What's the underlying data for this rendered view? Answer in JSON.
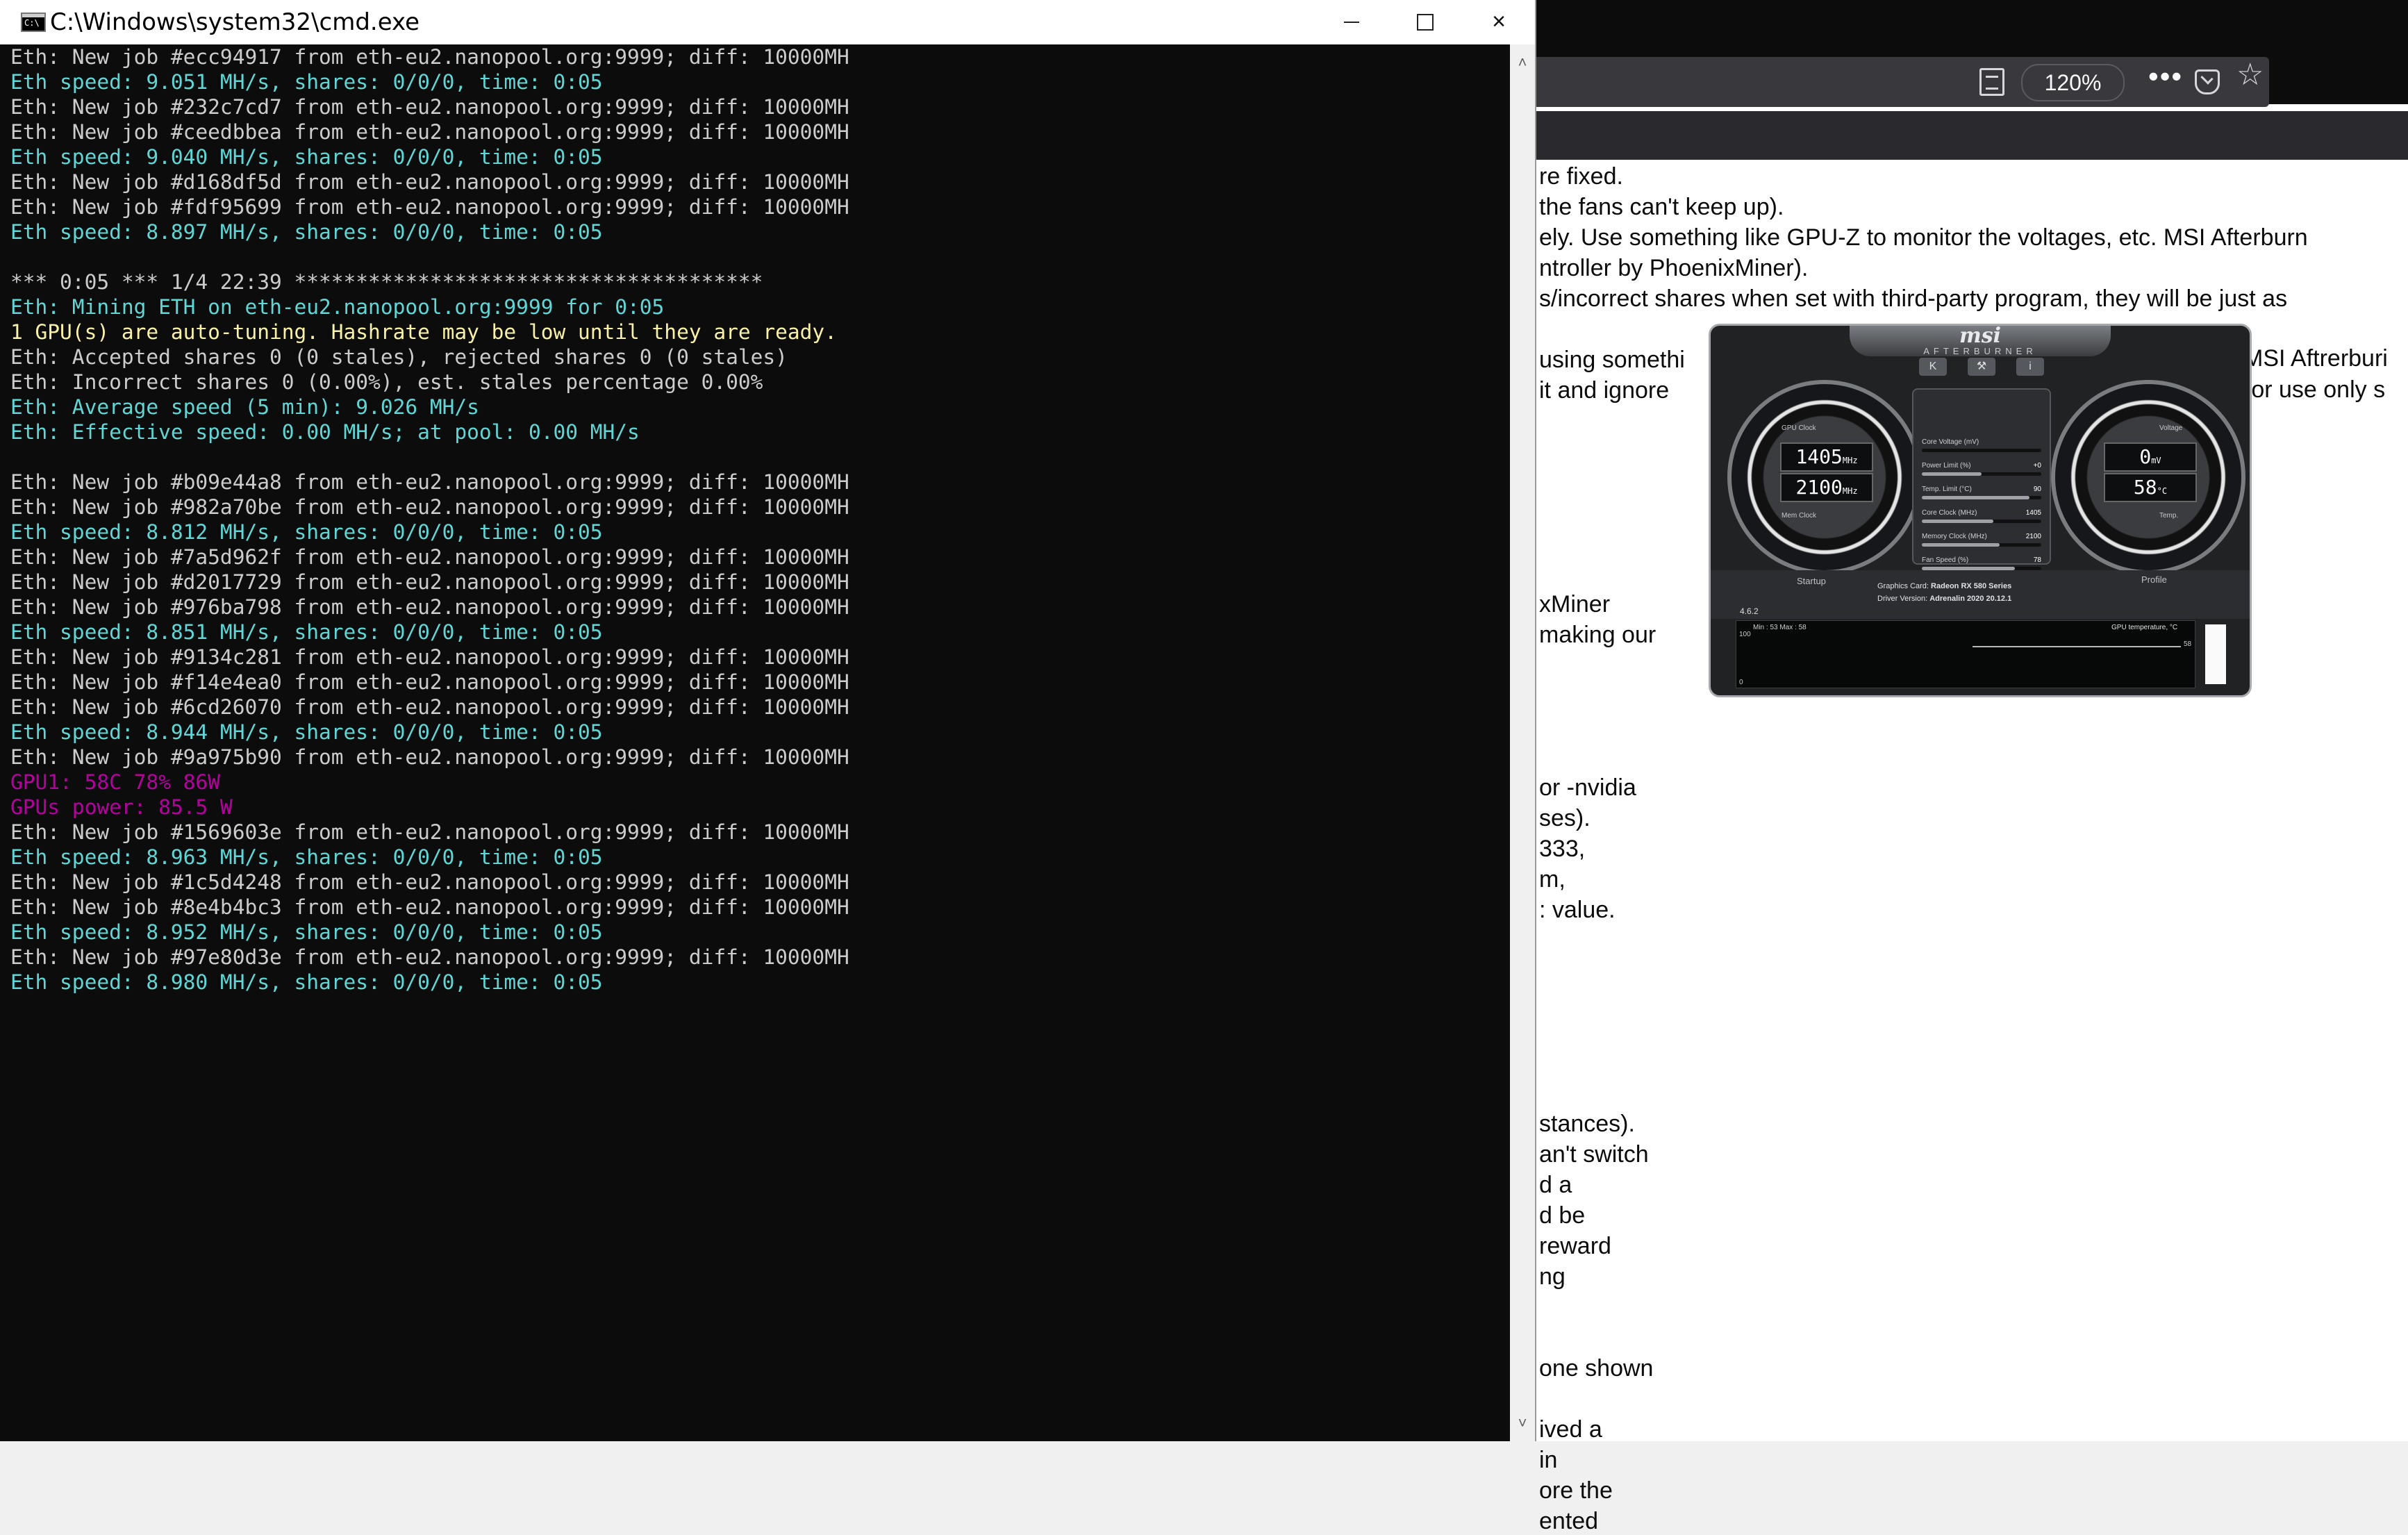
{
  "cmd": {
    "title": "C:\\Windows\\system32\\cmd.exe",
    "lines": [
      {
        "text": "Eth: New job #ecc94917 from eth-eu2.nanopool.org:9999; diff: 10000MH",
        "color": "white"
      },
      {
        "text": "Eth speed: 9.051 MH/s, shares: 0/0/0, time: 0:05",
        "color": "cyan"
      },
      {
        "text": "Eth: New job #232c7cd7 from eth-eu2.nanopool.org:9999; diff: 10000MH",
        "color": "white"
      },
      {
        "text": "Eth: New job #ceedbbea from eth-eu2.nanopool.org:9999; diff: 10000MH",
        "color": "white"
      },
      {
        "text": "Eth speed: 9.040 MH/s, shares: 0/0/0, time: 0:05",
        "color": "cyan"
      },
      {
        "text": "Eth: New job #d168df5d from eth-eu2.nanopool.org:9999; diff: 10000MH",
        "color": "white"
      },
      {
        "text": "Eth: New job #fdf95699 from eth-eu2.nanopool.org:9999; diff: 10000MH",
        "color": "white"
      },
      {
        "text": "Eth speed: 8.897 MH/s, shares: 0/0/0, time: 0:05",
        "color": "cyan"
      },
      {
        "text": "",
        "color": "white"
      },
      {
        "text": "*** 0:05 *** 1/4 22:39 **************************************",
        "color": "white"
      },
      {
        "text": "Eth: Mining ETH on eth-eu2.nanopool.org:9999 for 0:05",
        "color": "cyan"
      },
      {
        "text": "1 GPU(s) are auto-tuning. Hashrate may be low until they are ready.",
        "color": "yellow"
      },
      {
        "text": "Eth: Accepted shares 0 (0 stales), rejected shares 0 (0 stales)",
        "color": "white"
      },
      {
        "text": "Eth: Incorrect shares 0 (0.00%), est. stales percentage 0.00%",
        "color": "white"
      },
      {
        "text": "Eth: Average speed (5 min): 9.026 MH/s",
        "color": "cyan"
      },
      {
        "text": "Eth: Effective speed: 0.00 MH/s; at pool: 0.00 MH/s",
        "color": "cyan"
      },
      {
        "text": "",
        "color": "white"
      },
      {
        "text": "Eth: New job #b09e44a8 from eth-eu2.nanopool.org:9999; diff: 10000MH",
        "color": "white"
      },
      {
        "text": "Eth: New job #982a70be from eth-eu2.nanopool.org:9999; diff: 10000MH",
        "color": "white"
      },
      {
        "text": "Eth speed: 8.812 MH/s, shares: 0/0/0, time: 0:05",
        "color": "cyan"
      },
      {
        "text": "Eth: New job #7a5d962f from eth-eu2.nanopool.org:9999; diff: 10000MH",
        "color": "white"
      },
      {
        "text": "Eth: New job #d2017729 from eth-eu2.nanopool.org:9999; diff: 10000MH",
        "color": "white"
      },
      {
        "text": "Eth: New job #976ba798 from eth-eu2.nanopool.org:9999; diff: 10000MH",
        "color": "white"
      },
      {
        "text": "Eth speed: 8.851 MH/s, shares: 0/0/0, time: 0:05",
        "color": "cyan"
      },
      {
        "text": "Eth: New job #9134c281 from eth-eu2.nanopool.org:9999; diff: 10000MH",
        "color": "white"
      },
      {
        "text": "Eth: New job #f14e4ea0 from eth-eu2.nanopool.org:9999; diff: 10000MH",
        "color": "white"
      },
      {
        "text": "Eth: New job #6cd26070 from eth-eu2.nanopool.org:9999; diff: 10000MH",
        "color": "white"
      },
      {
        "text": "Eth speed: 8.944 MH/s, shares: 0/0/0, time: 0:05",
        "color": "cyan"
      },
      {
        "text": "Eth: New job #9a975b90 from eth-eu2.nanopool.org:9999; diff: 10000MH",
        "color": "white"
      },
      {
        "text": "GPU1: 58C 78% 86W",
        "color": "magenta"
      },
      {
        "text": "GPUs power: 85.5 W",
        "color": "magenta"
      },
      {
        "text": "Eth: New job #1569603e from eth-eu2.nanopool.org:9999; diff: 10000MH",
        "color": "white"
      },
      {
        "text": "Eth speed: 8.963 MH/s, shares: 0/0/0, time: 0:05",
        "color": "cyan"
      },
      {
        "text": "Eth: New job #1c5d4248 from eth-eu2.nanopool.org:9999; diff: 10000MH",
        "color": "white"
      },
      {
        "text": "Eth: New job #8e4b4bc3 from eth-eu2.nanopool.org:9999; diff: 10000MH",
        "color": "white"
      },
      {
        "text": "Eth speed: 8.952 MH/s, shares: 0/0/0, time: 0:05",
        "color": "cyan"
      },
      {
        "text": "Eth: New job #97e80d3e from eth-eu2.nanopool.org:9999; diff: 10000MH",
        "color": "white"
      },
      {
        "text": "Eth speed: 8.980 MH/s, shares: 0/0/0, time: 0:05",
        "color": "cyan"
      }
    ],
    "colors": {
      "white": "#cccccc",
      "cyan": "#61d6d6",
      "yellow": "#f9f1a5",
      "magenta": "#b4009e",
      "background": "#0c0c0c"
    },
    "buttons": {
      "minimize": "minimize-icon",
      "maximize": "maximize-icon",
      "close": "×"
    },
    "scroll_up": "˄",
    "scroll_down": "˅"
  },
  "browser": {
    "zoom": "120%",
    "menu": "•••",
    "star": "☆",
    "article_lines": [
      "re fixed.",
      " the fans can't keep up).",
      "ely. Use something like GPU-Z to monitor the voltages, etc. MSI Afterburn",
      "ntroller by PhoenixMiner).",
      "s/incorrect shares when set with third-party program, they will be just as",
      "",
      " using somethi",
      " it and ignore",
      "",
      "",
      "",
      "",
      "",
      "",
      "xMiner",
      "making our",
      "",
      "",
      "",
      "",
      "or -nvidia",
      "ses).",
      "333,",
      "m,",
      ": value.",
      "",
      "",
      "",
      "",
      "",
      "",
      "stances).",
      "an't switch",
      "d a",
      "d be",
      " reward",
      "ng",
      "",
      "",
      "one shown",
      "",
      "ived a",
      "in",
      "ore the",
      "ented"
    ],
    "article_right": [
      " MSI Aftrerburi",
      " (or use only s"
    ]
  },
  "afterburner": {
    "logo": "msi",
    "sublogo": "AFTERBURNER",
    "gpu_clock_label": "GPU Clock",
    "mem_clock_label": "Mem Clock",
    "gpu_clock": "1405",
    "mem_clock": "2100",
    "unit_mhz": "MHz",
    "voltage_label": "Voltage",
    "temp_label": "Temp.",
    "voltage": "0",
    "unit_mv": "mV",
    "temp": "58",
    "unit_c": "°C",
    "sliders": [
      {
        "name": "Core Voltage (mV)",
        "value": "",
        "level": 0
      },
      {
        "name": "Power Limit (%)",
        "value": "+0",
        "level": 0.5
      },
      {
        "name": "Temp. Limit (°C)",
        "value": "90",
        "level": 0.9
      },
      {
        "name": "Core Clock (MHz)",
        "value": "1405",
        "level": 0.6
      },
      {
        "name": "Memory Clock (MHz)",
        "value": "2100",
        "level": 0.65
      },
      {
        "name": "Fan Speed (%)",
        "value": "78",
        "level": 0.78
      }
    ],
    "startup": "Startup",
    "profile": "Profile",
    "graphics_card_label": "Graphics Card:",
    "graphics_card": "Radeon RX 580 Series",
    "driver_label": "Driver Version:",
    "driver": "Adrenalin 2020 20.12.1",
    "version": "4.6.2",
    "graph_label": "GPU temperature, °C",
    "graph_minmax": "Min : 53   Max : 58",
    "graph_top": "100",
    "graph_bottom": "0",
    "graph_value": "58"
  }
}
